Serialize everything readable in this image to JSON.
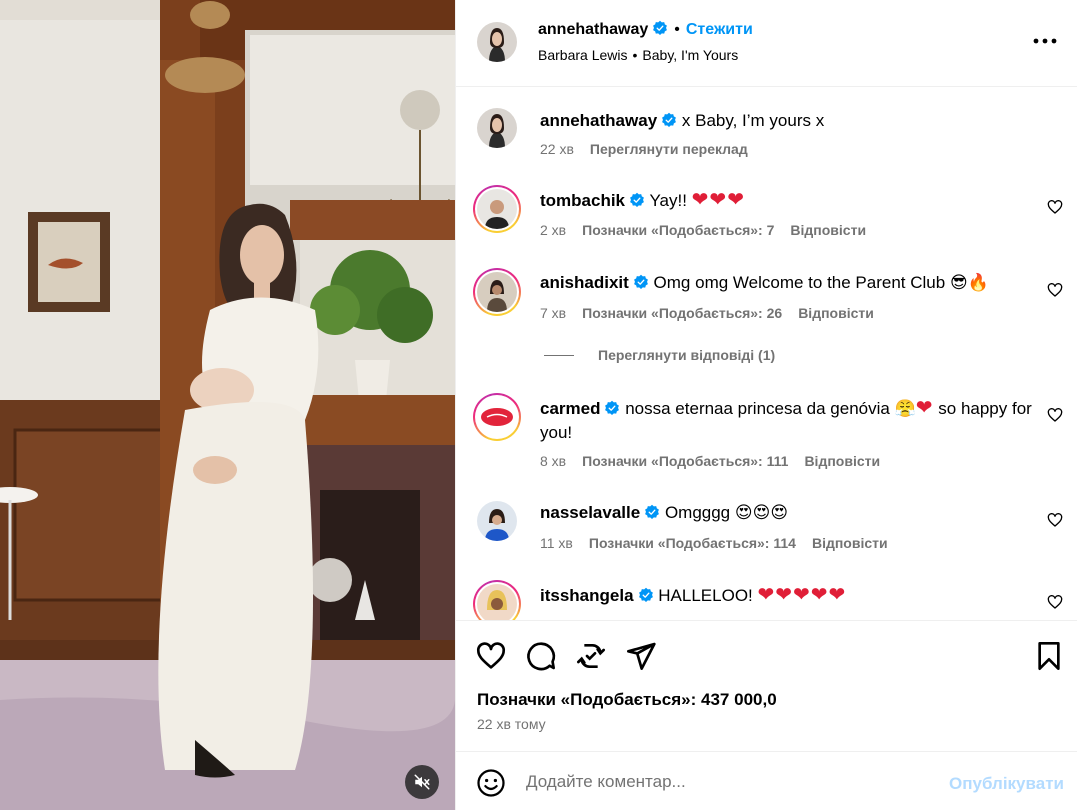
{
  "post": {
    "author": "annehathaway",
    "follow_label": "Стежити",
    "audio_artist": "Barbara Lewis",
    "audio_track": "Baby, I'm Yours"
  },
  "caption": {
    "username": "annehathaway",
    "text": "x Baby, I’m yours x",
    "time": "22 хв",
    "translate_label": "Переглянути переклад"
  },
  "comments": [
    {
      "username": "tombachik",
      "text": "Yay!!",
      "hearts": "❤❤❤",
      "emoji": "",
      "time": "2 хв",
      "likes": "Позначки «Подобається»: 7",
      "reply": "Відповісти"
    },
    {
      "username": "anishadixit",
      "text": "Omg omg Welcome to the Parent Club",
      "hearts": "",
      "emoji": "😎🔥",
      "time": "7 хв",
      "likes": "Позначки «Подобається»: 26",
      "reply": "Відповісти"
    },
    {
      "username": "carmed",
      "text": "nossa eternaa princesa da genóvia",
      "emoji": "😤",
      "hearts": "❤",
      "text_after": "so happy for you!",
      "time": "8 хв",
      "likes": "Позначки «Подобається»: 111",
      "reply": "Відповісти"
    },
    {
      "username": "nasselavalle",
      "text": "Omgggg",
      "emoji": "😍😍😍",
      "hearts": "",
      "time": "11 хв",
      "likes": "Позначки «Подобається»: 114",
      "reply": "Відповісти"
    },
    {
      "username": "itsshangela",
      "text": "HALLELOO!",
      "hearts": "❤❤❤❤❤",
      "emoji": ""
    }
  ],
  "view_replies_label": "Переглянути відповіді (1)",
  "likes_total": "Позначки «Подобається»: 437 000,0",
  "posted_ago": "22 хв тому",
  "comment_box": {
    "placeholder": "Додайте коментар...",
    "publish_label": "Опублікувати"
  },
  "icons": {
    "verified": "verified-badge-icon",
    "more": "more-options-icon",
    "like": "heart-icon",
    "comment": "comment-icon",
    "share": "repost-icon",
    "send": "send-icon",
    "save": "bookmark-icon",
    "emoji": "emoji-icon",
    "mute": "muted-audio-icon"
  },
  "colors": {
    "link": "#0095f6",
    "secondary_text": "#737373",
    "heart": "#e01e37",
    "publish_disabled": "#b3dbff"
  }
}
